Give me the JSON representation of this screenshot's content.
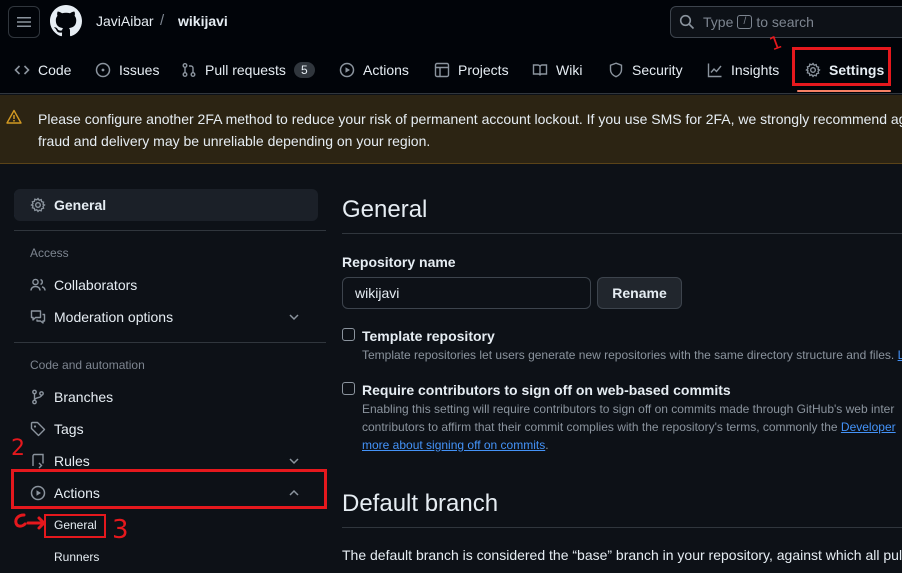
{
  "header": {
    "owner": "JaviAibar",
    "separator": "/",
    "repo": "wikijavi",
    "search": {
      "prefix": "Type",
      "key": "/",
      "suffix": "to search"
    }
  },
  "tabs": [
    {
      "label": "Code",
      "icon": "code-icon"
    },
    {
      "label": "Issues",
      "icon": "issue-opened-icon"
    },
    {
      "label": "Pull requests",
      "icon": "git-pull-request-icon",
      "count": "5"
    },
    {
      "label": "Actions",
      "icon": "play-icon"
    },
    {
      "label": "Projects",
      "icon": "table-icon"
    },
    {
      "label": "Wiki",
      "icon": "book-icon"
    },
    {
      "label": "Security",
      "icon": "shield-icon"
    },
    {
      "label": "Insights",
      "icon": "graph-icon"
    },
    {
      "label": "Settings",
      "icon": "gear-icon",
      "selected": true
    }
  ],
  "banner": {
    "line1": "Please configure another 2FA method to reduce your risk of permanent account lockout. If you use SMS for 2FA, we strongly recommend ag",
    "line2": "fraud and delivery may be unreliable depending on your region."
  },
  "sidebar": {
    "general": "General",
    "access_heading": "Access",
    "collaborators": "Collaborators",
    "moderation": "Moderation options",
    "code_heading": "Code and automation",
    "branches": "Branches",
    "tags": "Tags",
    "rules": "Rules",
    "actions": "Actions",
    "actions_sub": [
      "General",
      "Runners"
    ]
  },
  "main": {
    "title": "General",
    "repo_name_label": "Repository name",
    "repo_name_value": "wikijavi",
    "rename_button": "Rename",
    "template": {
      "label": "Template repository",
      "note": "Template repositories let users generate new repositories with the same directory structure and files.",
      "note_link": "Le"
    },
    "signoff": {
      "label": "Require contributors to sign off on web-based commits",
      "note1": "Enabling this setting will require contributors to sign off on commits made through GitHub's web inter",
      "note2": "contributors to affirm that their commit complies with the repository's terms, commonly the",
      "note2_link": "Developer",
      "note3_link": "more about signing off on commits",
      "note3_end": "."
    },
    "default_branch_title": "Default branch",
    "default_branch_text": "The default branch is considered the “base” branch in your repository, against which all pul"
  },
  "annotations": [
    "1",
    "2",
    "3"
  ],
  "colors": {
    "accent": "#2f81f7",
    "tab_underline": "#f78166",
    "annotation_red": "#e5181d",
    "banner_bg": "#2c2413"
  }
}
